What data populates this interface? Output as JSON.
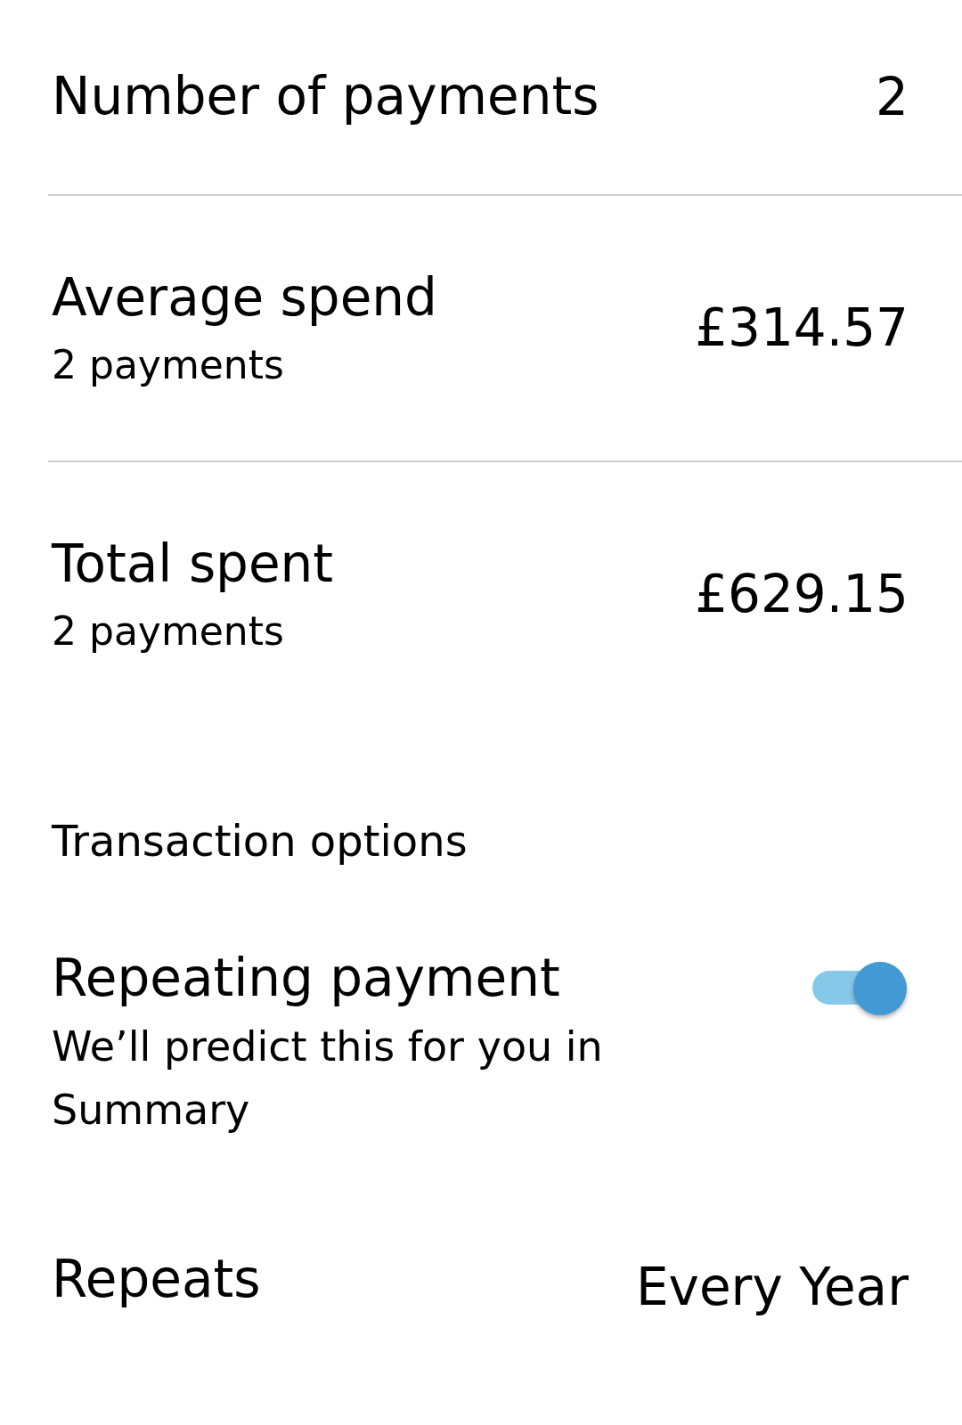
{
  "stats": [
    {
      "label": "Number of payments",
      "value": "2"
    },
    {
      "label": "Average spend",
      "sublabel": "2 payments",
      "value": "£314.57"
    },
    {
      "label": "Total spent",
      "sublabel": "2 payments",
      "value": "£629.15"
    }
  ],
  "section_title": "Transaction options",
  "options": [
    {
      "kind": "toggle",
      "label": "Repeating payment",
      "description": "We’ll predict this for you in Summary",
      "on": true
    },
    {
      "kind": "value",
      "label": "Repeats",
      "value": "Every Year"
    }
  ]
}
